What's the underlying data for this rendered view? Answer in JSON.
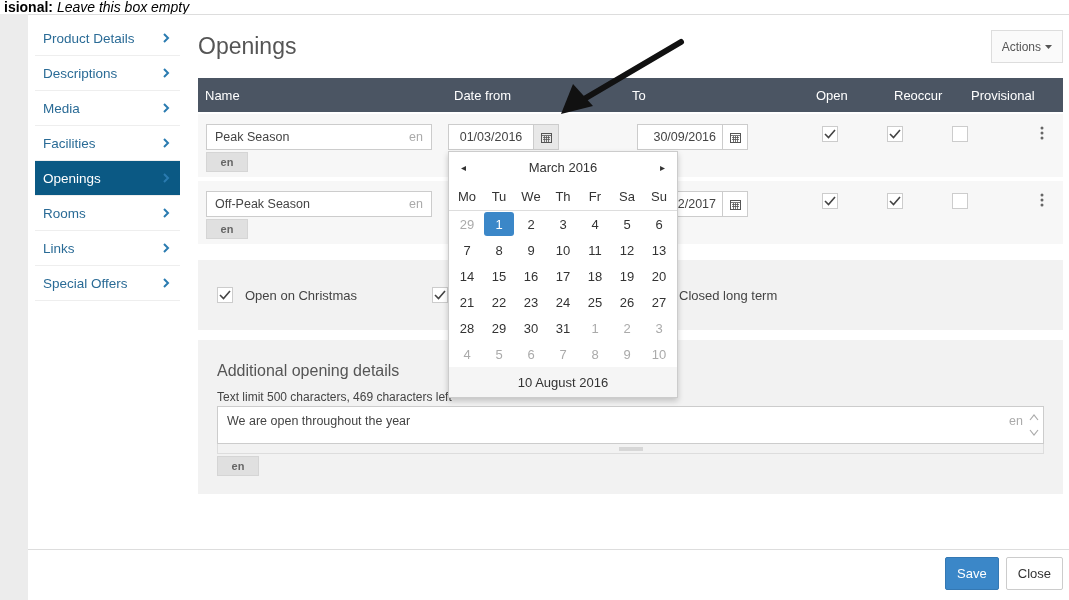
{
  "heading": "**isional:** *Leave this box empty*",
  "sidebar": {
    "items": [
      {
        "label": "Product Details",
        "selected": false
      },
      {
        "label": "Descriptions",
        "selected": false
      },
      {
        "label": "Media",
        "selected": false
      },
      {
        "label": "Facilities",
        "selected": false
      },
      {
        "label": "Openings",
        "selected": true
      },
      {
        "label": "Rooms",
        "selected": false
      },
      {
        "label": "Links",
        "selected": false
      },
      {
        "label": "Special Offers",
        "selected": false
      }
    ]
  },
  "page_title": "Openings",
  "actions_button": "Actions",
  "table": {
    "columns": [
      "Name",
      "Date from",
      "To",
      "Open",
      "Reoccur",
      "Provisional"
    ],
    "rows": [
      {
        "name": "Peak Season",
        "name_lang": "en",
        "lang_tag": "en",
        "date_from": "01/03/2016",
        "to": "30/09/2016",
        "open": true,
        "reoccur": true,
        "provisional": false
      },
      {
        "name": "Off-Peak Season",
        "name_lang": "en",
        "lang_tag": "en",
        "to": "2/2017",
        "open": true,
        "reoccur": true,
        "provisional": false
      }
    ]
  },
  "datepicker": {
    "prev": "◂",
    "title": "March 2016",
    "next": "▸",
    "weekdays": [
      "Mo",
      "Tu",
      "We",
      "Th",
      "Fr",
      "Sa",
      "Su"
    ],
    "days": [
      {
        "d": "29",
        "muted": true,
        "selected": false
      },
      {
        "d": "1",
        "muted": false,
        "selected": true
      },
      {
        "d": "2",
        "muted": false,
        "selected": false
      },
      {
        "d": "3",
        "muted": false,
        "selected": false
      },
      {
        "d": "4",
        "muted": false,
        "selected": false
      },
      {
        "d": "5",
        "muted": false,
        "selected": false
      },
      {
        "d": "6",
        "muted": false,
        "selected": false
      },
      {
        "d": "7",
        "muted": false,
        "selected": false
      },
      {
        "d": "8",
        "muted": false,
        "selected": false
      },
      {
        "d": "9",
        "muted": false,
        "selected": false
      },
      {
        "d": "10",
        "muted": false,
        "selected": false
      },
      {
        "d": "11",
        "muted": false,
        "selected": false
      },
      {
        "d": "12",
        "muted": false,
        "selected": false
      },
      {
        "d": "13",
        "muted": false,
        "selected": false
      },
      {
        "d": "14",
        "muted": false,
        "selected": false
      },
      {
        "d": "15",
        "muted": false,
        "selected": false
      },
      {
        "d": "16",
        "muted": false,
        "selected": false
      },
      {
        "d": "17",
        "muted": false,
        "selected": false
      },
      {
        "d": "18",
        "muted": false,
        "selected": false
      },
      {
        "d": "19",
        "muted": false,
        "selected": false
      },
      {
        "d": "20",
        "muted": false,
        "selected": false
      },
      {
        "d": "21",
        "muted": false,
        "selected": false
      },
      {
        "d": "22",
        "muted": false,
        "selected": false
      },
      {
        "d": "23",
        "muted": false,
        "selected": false
      },
      {
        "d": "24",
        "muted": false,
        "selected": false
      },
      {
        "d": "25",
        "muted": false,
        "selected": false
      },
      {
        "d": "26",
        "muted": false,
        "selected": false
      },
      {
        "d": "27",
        "muted": false,
        "selected": false
      },
      {
        "d": "28",
        "muted": false,
        "selected": false
      },
      {
        "d": "29",
        "muted": false,
        "selected": false
      },
      {
        "d": "30",
        "muted": false,
        "selected": false
      },
      {
        "d": "31",
        "muted": false,
        "selected": false
      },
      {
        "d": "1",
        "muted": true,
        "selected": false
      },
      {
        "d": "2",
        "muted": true,
        "selected": false
      },
      {
        "d": "3",
        "muted": true,
        "selected": false
      },
      {
        "d": "4",
        "muted": true,
        "selected": false
      },
      {
        "d": "5",
        "muted": true,
        "selected": false
      },
      {
        "d": "6",
        "muted": true,
        "selected": false
      },
      {
        "d": "7",
        "muted": true,
        "selected": false
      },
      {
        "d": "8",
        "muted": true,
        "selected": false
      },
      {
        "d": "9",
        "muted": true,
        "selected": false
      },
      {
        "d": "10",
        "muted": true,
        "selected": false
      }
    ],
    "today": "10 August 2016"
  },
  "options": [
    {
      "label": "Open on Christmas",
      "checked": true
    },
    {
      "checked": true
    },
    {
      "label": "Closed long term"
    }
  ],
  "details": {
    "title": "Additional opening details",
    "limit_text": "Text limit 500 characters, 469 characters left",
    "value": "We are open throughout the year",
    "lang": "en",
    "lang_tag": "en"
  },
  "footer": {
    "buttons": [
      {
        "label": "Save",
        "kind": "primary"
      },
      {
        "label": "Close",
        "kind": "default"
      }
    ]
  }
}
